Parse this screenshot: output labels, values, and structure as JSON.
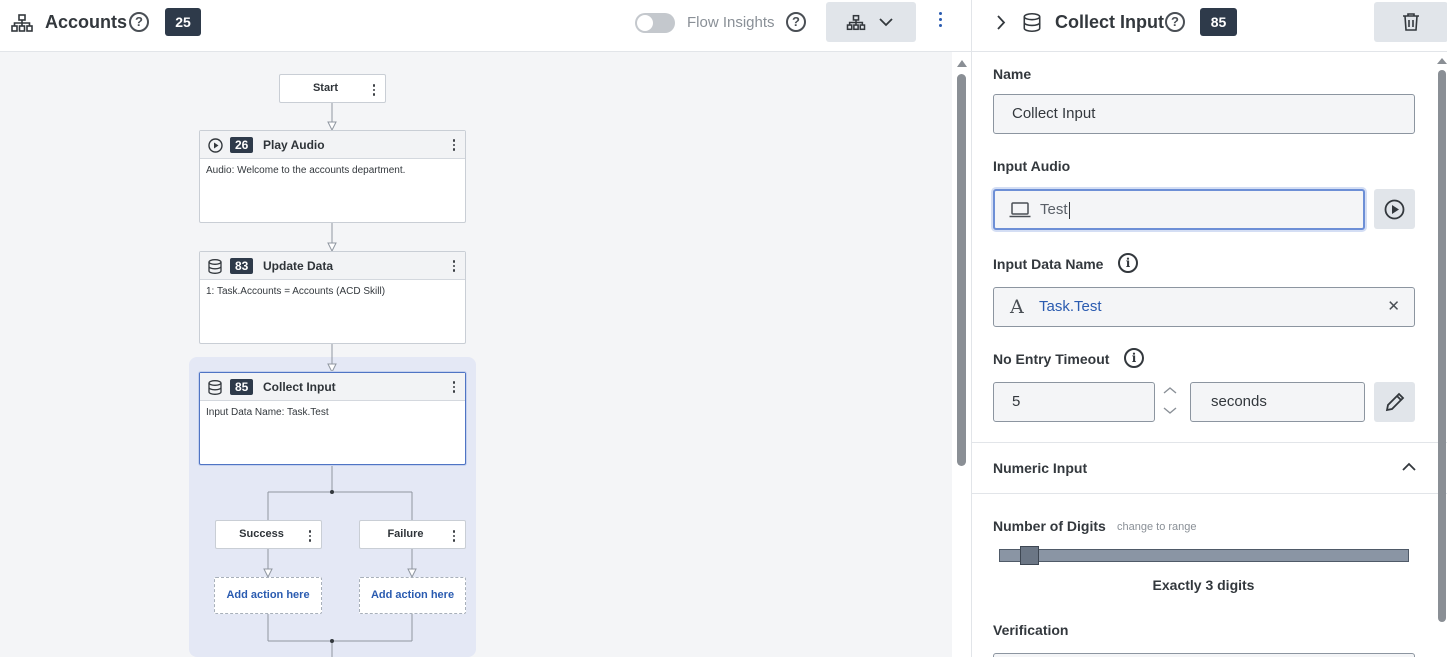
{
  "header": {
    "title": "Accounts",
    "badge": "25",
    "flow_insights_label": "Flow Insights",
    "flow_insights_on": false
  },
  "flow": {
    "start_label": "Start",
    "nodes": [
      {
        "id": "26",
        "name": "Play Audio",
        "icon": "play-icon",
        "body": "Audio: Welcome to the accounts department."
      },
      {
        "id": "83",
        "name": "Update Data",
        "icon": "database-icon",
        "body": "1: Task.Accounts = Accounts (ACD Skill)"
      },
      {
        "id": "85",
        "name": "Collect Input",
        "icon": "database-icon",
        "body": "Input Data Name: Task.Test"
      }
    ],
    "branches": [
      {
        "label": "Success",
        "add_label": "Add action here"
      },
      {
        "label": "Failure",
        "add_label": "Add action here"
      }
    ]
  },
  "panel": {
    "title": "Collect Input",
    "badge": "85",
    "name_label": "Name",
    "name_value": "Collect Input",
    "input_audio_label": "Input Audio",
    "input_audio_value": "Test",
    "input_data_name_label": "Input Data Name",
    "input_data_name_value": "Task.Test",
    "no_entry_timeout_label": "No Entry Timeout",
    "timeout_value": "5",
    "timeout_unit": "seconds",
    "numeric_input_label": "Numeric Input",
    "number_of_digits_label": "Number of Digits",
    "change_to_range_label": "change to range",
    "digits_text": "Exactly 3 digits",
    "digits_value": 3,
    "verification_label": "Verification"
  },
  "colors": {
    "badge_bg": "#2e3a4a",
    "accent_blue": "#2a5bb0",
    "selection_bg": "#e4e8f5"
  }
}
